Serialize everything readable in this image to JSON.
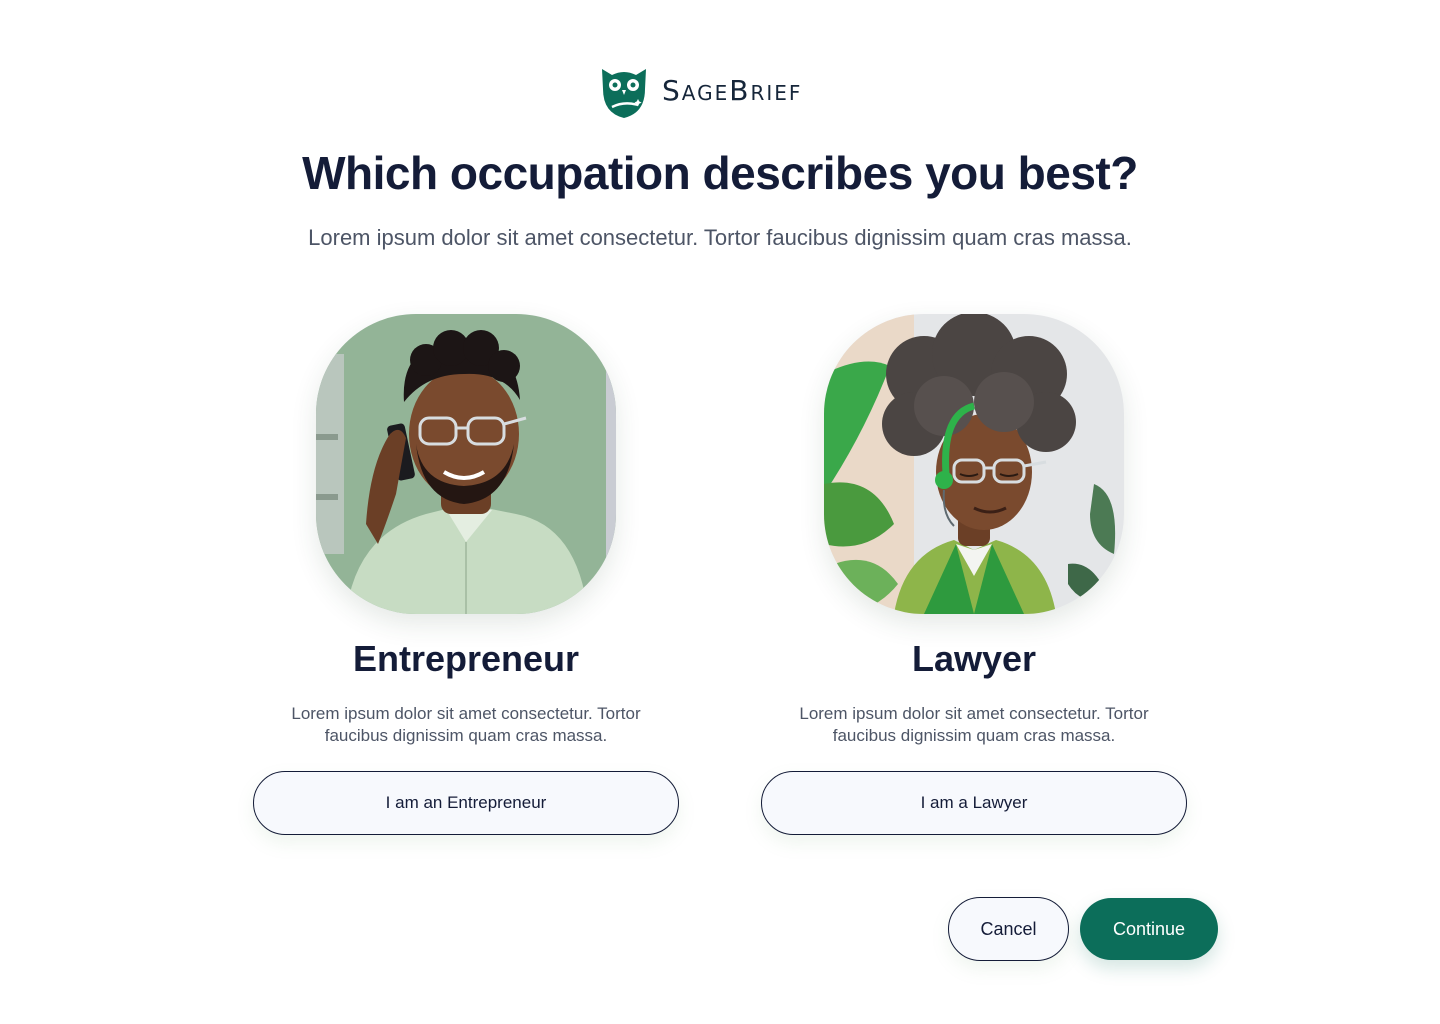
{
  "brand": {
    "name": "SageBrief",
    "color": "#0c6e5a"
  },
  "heading": {
    "title": "Which occupation describes you best?",
    "subtitle": "Lorem ipsum dolor sit amet consectetur. Tortor faucibus dignissim quam cras massa."
  },
  "options": [
    {
      "title": "Entrepreneur",
      "description": "Lorem ipsum dolor sit amet consectetur. Tortor faucibus dignissim quam cras massa.",
      "button_label": "I am an Entrepreneur",
      "image": "entrepreneur-avatar"
    },
    {
      "title": "Lawyer",
      "description": "Lorem ipsum dolor sit amet consectetur. Tortor faucibus dignissim quam cras massa.",
      "button_label": "I am a Lawyer",
      "image": "lawyer-avatar"
    }
  ],
  "actions": {
    "cancel_label": "Cancel",
    "continue_label": "Continue"
  }
}
